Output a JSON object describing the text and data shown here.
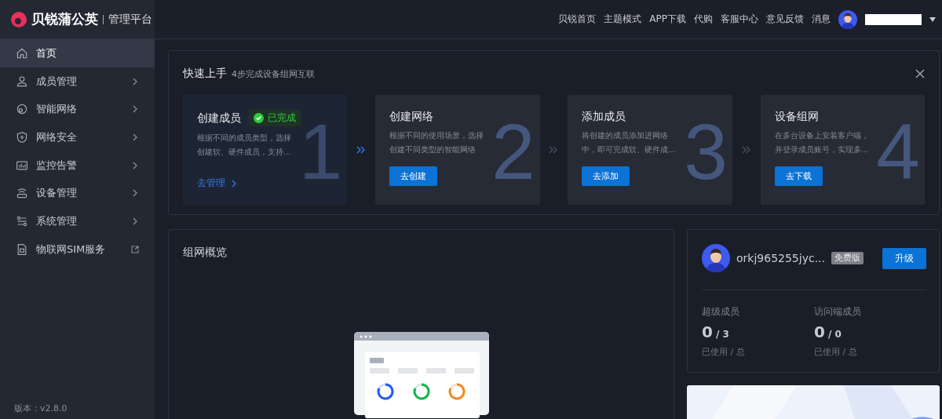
{
  "brand": {
    "name": "贝锐蒲公英",
    "subtitle": "管理平台"
  },
  "sidebar": {
    "items": [
      {
        "label": "首页",
        "kind": "page",
        "selected": true
      },
      {
        "label": "成员管理",
        "kind": "submenu",
        "selected": false
      },
      {
        "label": "智能网络",
        "kind": "submenu",
        "selected": false
      },
      {
        "label": "网络安全",
        "kind": "submenu",
        "selected": false
      },
      {
        "label": "监控告警",
        "kind": "submenu",
        "selected": false
      },
      {
        "label": "设备管理",
        "kind": "submenu",
        "selected": false
      },
      {
        "label": "系统管理",
        "kind": "submenu",
        "selected": false
      },
      {
        "label": "物联网SIM服务",
        "kind": "external",
        "selected": false
      }
    ],
    "version": "版本：v2.8.0"
  },
  "header": {
    "links": [
      "贝锐首页",
      "主题模式",
      "APP下载",
      "代购",
      "客服中心",
      "意见反馈",
      "消息"
    ]
  },
  "quick_start": {
    "title": "快速上手",
    "subtitle": "4步完成设备组网互联",
    "steps": [
      {
        "number": "1",
        "title": "创建成员",
        "completed": true,
        "badge": "已完成",
        "description": "根据不同的成员类型，选择创建软、硬件成员，支持...",
        "action": "去管理"
      },
      {
        "number": "2",
        "title": "创建网络",
        "completed": false,
        "description": "根据不同的使用场景，选择创建不同类型的智能网络",
        "action": "去创建"
      },
      {
        "number": "3",
        "title": "添加成员",
        "completed": false,
        "description": "将创建的成员添加进网络中，即可完成软、硬件成...",
        "action": "去添加"
      },
      {
        "number": "4",
        "title": "设备组网",
        "completed": false,
        "description": "在多台设备上安装客户端，并登录成员账号，实现多...",
        "action": "去下载"
      }
    ]
  },
  "overview": {
    "title": "组网概览"
  },
  "account": {
    "name": "orkj965255jyc...",
    "plan": "免费版",
    "upgrade": "升级",
    "stats": [
      {
        "label": "超级成员",
        "used": "0",
        "total": "/ 3",
        "caption": "已使用 / 总"
      },
      {
        "label": "访问端成员",
        "used": "0",
        "total": "/ 0",
        "caption": "已使用 / 总"
      }
    ]
  }
}
